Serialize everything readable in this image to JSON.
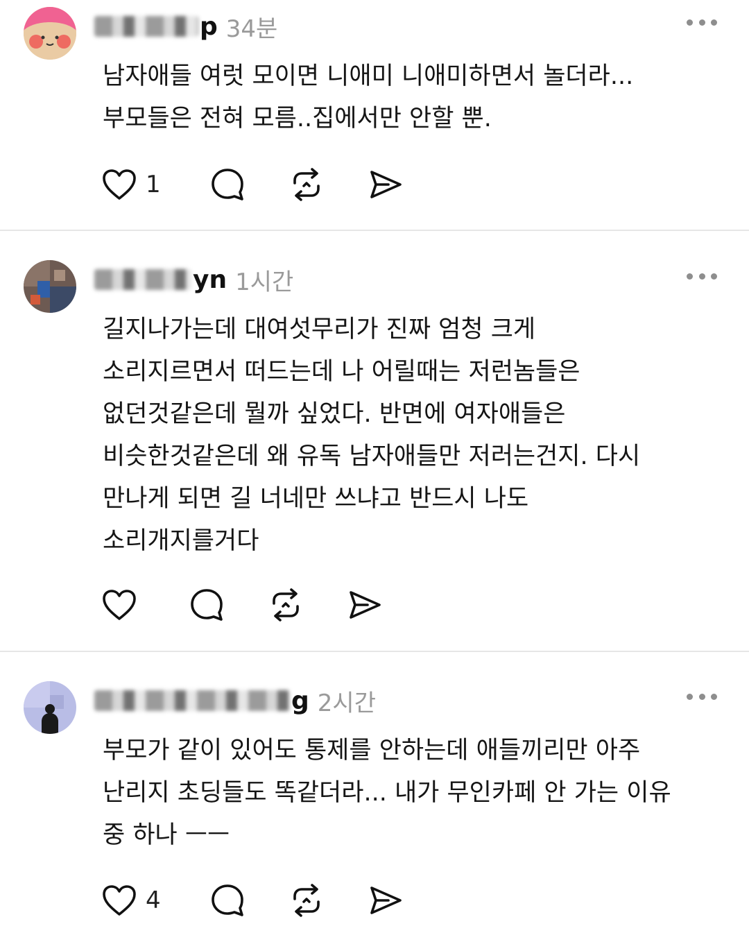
{
  "comments": [
    {
      "username_visible": "p",
      "time": "34분",
      "text": "남자애들 여럿 모이면 니애미 니애미하면서 놀더라...\n부모들은 전혀 모름..집에서만 안할 뿐.",
      "likes": "1",
      "avatar_colors": {
        "bg": "#e9c9a0",
        "hair": "#f06292",
        "cheek": "#ef5350"
      }
    },
    {
      "username_visible": "yn",
      "time": "1시간",
      "text": "길지나가는데 대여섯무리가 진짜 엄청 크게\n소리지르면서 떠드는데 나 어릴때는 저런놈들은\n없던것같은데 뭘까 싶었다. 반면에 여자애들은\n비슷한것같은데 왜 유독 남자애들만 저러는건지. 다시\n만나게 되면 길 너네만 쓰냐고 반드시 나도\n소리개지를거다",
      "likes": "",
      "avatar_colors": {
        "bg": "#6d5a52",
        "accent": "#2f5fa8"
      }
    },
    {
      "username_visible": "g",
      "time": "2시간",
      "text": "부모가 같이 있어도 통제를 안하는데 애들끼리만 아주\n난리지 초딩들도 똑같더라... 내가 무인카페 안 가는 이유\n중 하나 ㅡㅡ",
      "likes": "4",
      "avatar_colors": {
        "bg": "#b9bde6",
        "figure": "#1a1a1a"
      }
    }
  ],
  "icons": [
    "heart-icon",
    "comment-icon",
    "repost-icon",
    "share-icon",
    "more-icon"
  ]
}
